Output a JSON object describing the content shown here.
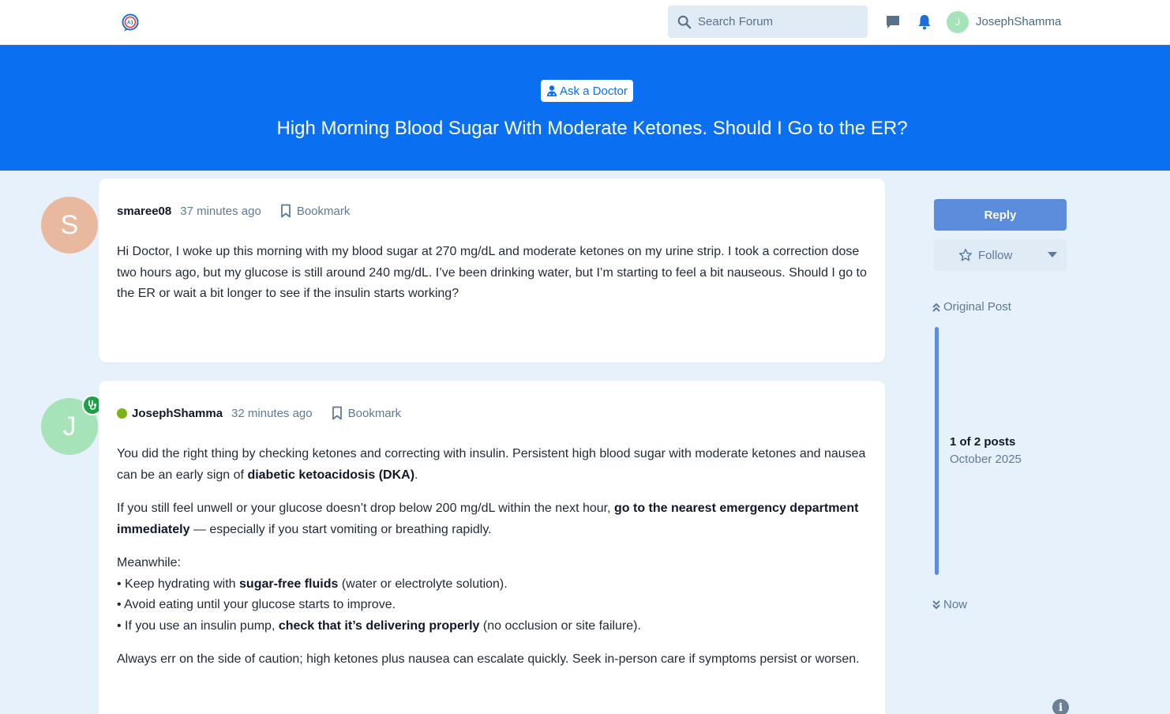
{
  "topbar": {
    "search_placeholder": "Search Forum",
    "username": "JosephShamma",
    "avatar_initial": "J",
    "icons": [
      "logo-icon",
      "search-icon",
      "chat-icon",
      "bell-icon"
    ]
  },
  "hero": {
    "badge_label": "Ask a Doctor",
    "title": "High Morning Blood Sugar With Moderate Ketones. Should I Go to the ER?"
  },
  "posts": [
    {
      "avatar_initial": "S",
      "author": "smaree08",
      "time": "37 minutes ago",
      "bookmark_label": "Bookmark",
      "paragraphs": [
        "Hi Doctor, I woke up this morning with my blood sugar at 270 mg/dL and moderate ketones on my urine strip. I took a correction dose two hours ago, but my glucose is still around 240 mg/dL. I’ve been drinking water, but I’m starting to feel a bit nauseous. Should I go to the ER or wait a bit longer to see if the insulin starts working?"
      ]
    },
    {
      "avatar_initial": "J",
      "author": "JosephShamma",
      "time": "32 minutes ago",
      "bookmark_label": "Bookmark",
      "p1_a": "You did the right thing by checking ketones and correcting with insulin. Persistent high blood sugar with moderate ketones and nausea can be an early sign of ",
      "p1_b": "diabetic ketoacidosis (DKA)",
      "p1_c": ".",
      "p2_a": "If you still feel unwell or your glucose doesn’t drop below 200 mg/dL within the next hour, ",
      "p2_b": "go to the nearest emergency department immediately",
      "p2_c": " — especially if you start vomiting or breathing rapidly.",
      "p3_head": "Meanwhile:",
      "b1_a": "• Keep hydrating with ",
      "b1_b": "sugar-free fluids",
      "b1_c": " (water or electrolyte solution).",
      "b2": "• Avoid eating until your glucose starts to improve.",
      "b3_a": "• If you use an insulin pump, ",
      "b3_b": "check that it’s delivering properly",
      "b3_c": " (no occlusion or site failure).",
      "p4": "Always err on the side of caution; high ketones plus nausea can escalate quickly. Seek in-person care if symptoms persist or worsen."
    }
  ],
  "sidebar": {
    "reply_label": "Reply",
    "follow_label": "Follow",
    "original_post_label": "Original Post",
    "count_label": "1 of 2 posts",
    "date_label": "October 2025",
    "now_label": "Now"
  },
  "colors": {
    "hero_bg": "#0a6ff0",
    "page_bg": "#e6f1fc",
    "reply_bg": "#5b8ddc",
    "online": "#7ab317",
    "doctor_badge": "#1e9e49"
  }
}
